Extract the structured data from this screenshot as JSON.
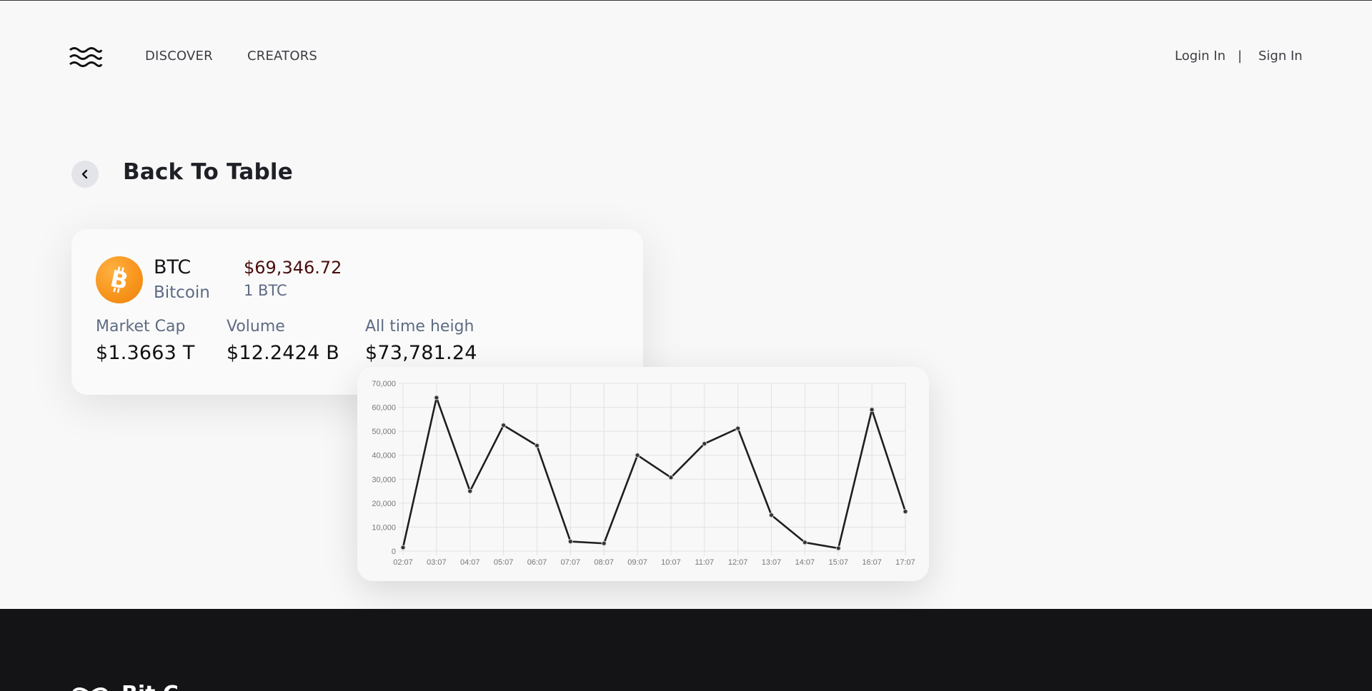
{
  "header": {
    "nav": {
      "discover": "DISCOVER",
      "creators": "CREATORS"
    },
    "auth": {
      "login": "Login In",
      "separator": "|",
      "signin": "Sign In"
    }
  },
  "back": {
    "title": "Back To Table",
    "icon": "chevron-left-icon"
  },
  "coin": {
    "icon": "bitcoin-icon",
    "icon_color": "#f7931a",
    "symbol": "BTC",
    "name": "Bitcoin",
    "price": "$69,346.72",
    "unit": "1 BTC",
    "stats": [
      {
        "label": "Market Cap",
        "value": "$1.3663 T"
      },
      {
        "label": "Volume",
        "value": "$12.2424 B"
      },
      {
        "label": "All time heigh",
        "value": "$73,781.24"
      }
    ]
  },
  "chart_data": {
    "type": "line",
    "x": [
      "02:07",
      "03:07",
      "04:07",
      "05:07",
      "06:07",
      "07:07",
      "08:07",
      "09:07",
      "10:07",
      "11:07",
      "12:07",
      "13:07",
      "14:07",
      "15:07",
      "16:07",
      "17:07"
    ],
    "values": [
      1500,
      64000,
      25000,
      52500,
      44000,
      4000,
      3200,
      40000,
      30700,
      44800,
      51200,
      15000,
      3600,
      1200,
      59000,
      16500
    ],
    "yticks": [
      "0",
      "10,000",
      "20,000",
      "30,000",
      "40,000",
      "50,000",
      "60,000",
      "70,000"
    ],
    "ylim": [
      0,
      70000
    ],
    "grid": true,
    "line_color": "#1f1f1f"
  },
  "footer": {
    "brand": "Bit C",
    "logo": "infinity-logo-icon"
  }
}
